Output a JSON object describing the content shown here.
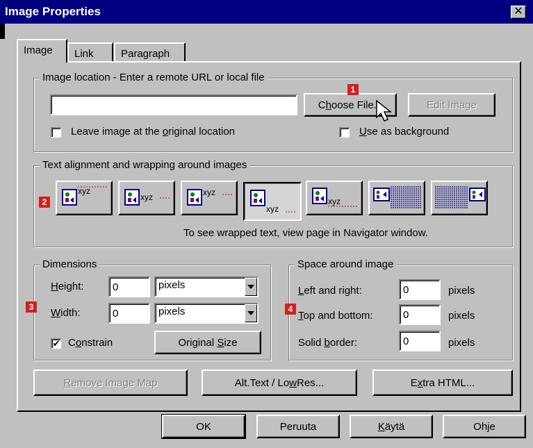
{
  "window": {
    "title": "Image Properties",
    "close_glyph": "✕"
  },
  "tabs": [
    {
      "label": "Image",
      "active": true
    },
    {
      "label": "Link",
      "active": false
    },
    {
      "label": "Paragraph",
      "active": false
    }
  ],
  "location": {
    "legend": "Image location - Enter a remote URL or local file",
    "url_value": "",
    "choose_pre": "C",
    "choose_ul": "h",
    "choose_post": "oose File...",
    "edit_label": "Edit Image",
    "leave_pre": "Leave image at the ",
    "leave_ul": "o",
    "leave_post": "riginal location",
    "leave_checked": false,
    "bg_pre": "",
    "bg_ul": "U",
    "bg_post": "se as background",
    "bg_checked": false
  },
  "alignment": {
    "legend": "Text alignment and wrapping around images",
    "sample_text": "xyz",
    "note": "To see wrapped text, view page in Navigator window."
  },
  "dimensions": {
    "legend": "Dimensions",
    "height_pre": "",
    "height_ul": "H",
    "height_post": "eight:",
    "height_value": "0",
    "height_unit": "pixels",
    "width_pre": "",
    "width_ul": "W",
    "width_post": "idth:",
    "width_value": "0",
    "width_unit": "pixels",
    "constrain_pre": "C",
    "constrain_ul": "o",
    "constrain_post": "nstrain",
    "constrain_checked": true,
    "check_glyph": "✔",
    "orig_pre": "Original ",
    "orig_ul": "S",
    "orig_post": "ize"
  },
  "space": {
    "legend": "Space around image",
    "lr_pre": "",
    "lr_ul": "L",
    "lr_post": "eft and right:",
    "lr_value": "0",
    "tb_pre": "",
    "tb_ul": "T",
    "tb_post": "op and bottom:",
    "tb_value": "0",
    "sb_pre": "Solid ",
    "sb_ul": "b",
    "sb_post": "order:",
    "sb_value": "0",
    "unit": "pixels"
  },
  "actions": {
    "remove_pre": "",
    "remove_ul": "R",
    "remove_post": "emove Image Map",
    "alt_pre": "Alt.Text / Lo",
    "alt_ul": "w",
    "alt_post": "Res...",
    "extra_pre": "E",
    "extra_ul": "x",
    "extra_post": "tra HTML..."
  },
  "footer": {
    "ok": "OK",
    "cancel": "Peruuta",
    "apply_pre": "",
    "apply_ul": "K",
    "apply_post": "äytä",
    "help": "Ohje"
  },
  "callouts": [
    "1",
    "2",
    "3",
    "4"
  ],
  "icons": {
    "close": "close-icon",
    "arrow": "mouse-pointer-icon",
    "dropdown": "dropdown-arrow-icon",
    "picture": "picture-icon"
  }
}
